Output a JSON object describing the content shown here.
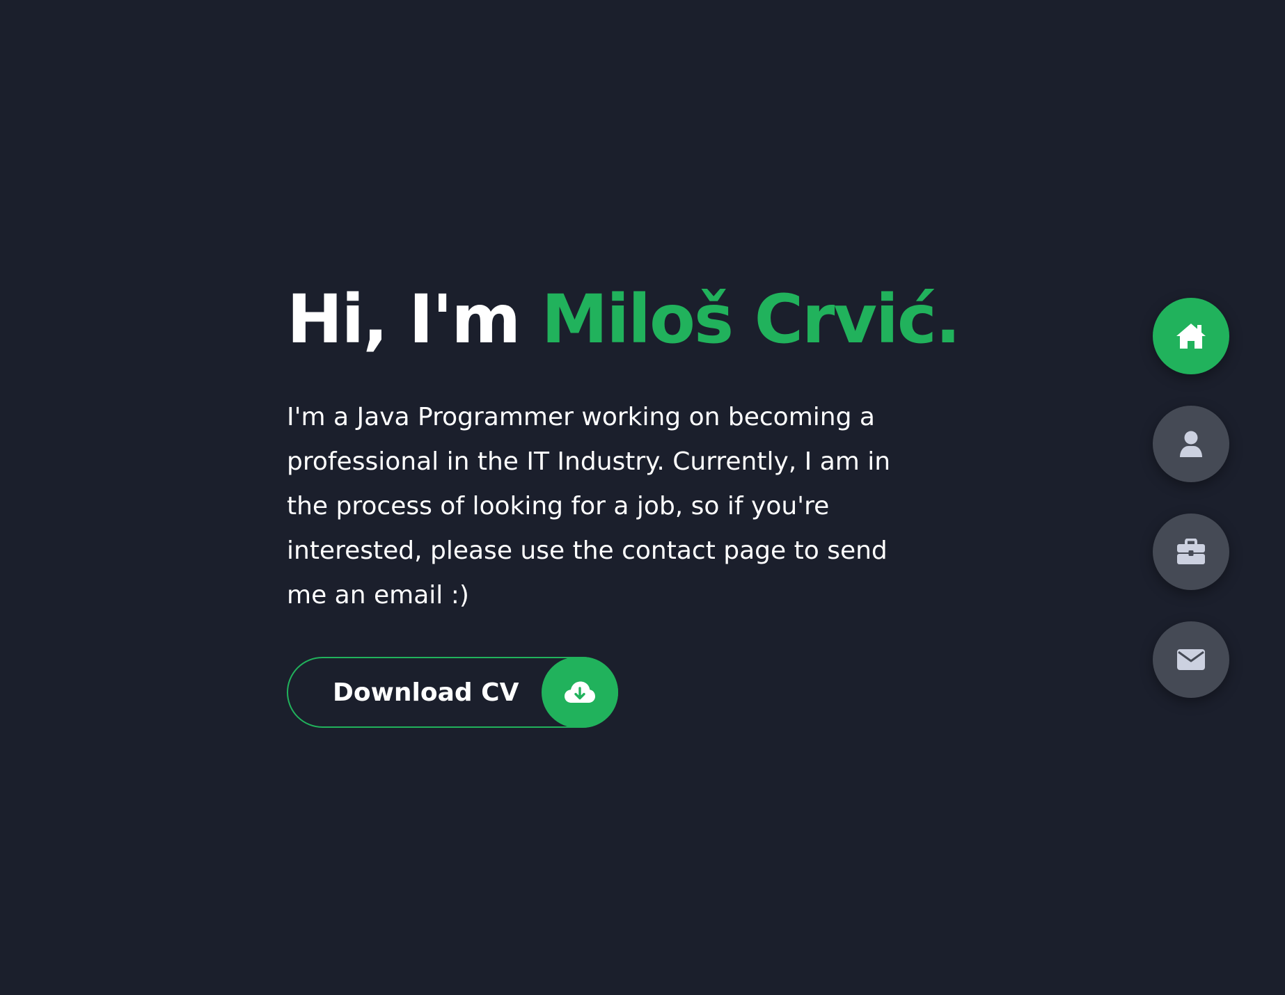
{
  "hero": {
    "greeting": "Hi, I'm ",
    "name": "Miloš Crvić.",
    "description": "I'm a Java Programmer working on becoming a professional in the IT Industry. Currently, I am in the process of looking for a job, so if you're interested, please use the contact page to send me an email :)",
    "cv_button_label": "Download CV",
    "cv_button_icon": "cloud-download-icon"
  },
  "side_nav": {
    "items": [
      {
        "icon": "home-icon",
        "active": true
      },
      {
        "icon": "user-icon",
        "active": false
      },
      {
        "icon": "briefcase-icon",
        "active": false
      },
      {
        "icon": "envelope-icon",
        "active": false
      }
    ]
  },
  "colors": {
    "background": "#1b1f2c",
    "accent": "#21b25c",
    "nav_inactive": "#454a55",
    "text": "#ffffff"
  }
}
